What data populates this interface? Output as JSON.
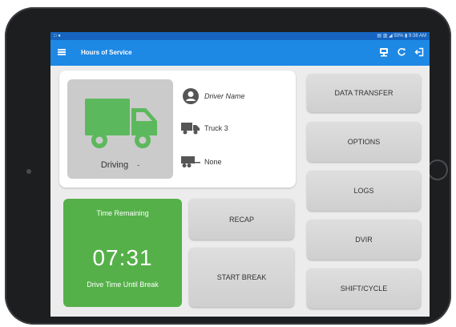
{
  "statusbar": {
    "left": "□ ●",
    "right": "▤ ▥ ◢ 93% ▮ 9:38 AM"
  },
  "appbar": {
    "title": "Hours of Service",
    "icons": [
      "menu-icon",
      "computer-icon",
      "refresh-icon",
      "logout-icon"
    ]
  },
  "driver": {
    "status": "Driving",
    "status_caret": "-",
    "name": "Driver Name",
    "vehicle": "Truck 3",
    "trailer": "None"
  },
  "time": {
    "title": "Time Remaining",
    "value": "07:31",
    "subtitle": "Drive Time Until Break"
  },
  "buttons": {
    "recap": "RECAP",
    "start_break": "START BREAK",
    "data_transfer": "DATA TRANSFER",
    "options": "OPTIONS",
    "logs": "LOGS",
    "dvir": "DVIR",
    "shift_cycle": "SHIFT/CYCLE"
  },
  "colors": {
    "appbar": "#1e88e5",
    "statusbar": "#1565c0",
    "driving_green": "#55b049",
    "truck_green": "#5cb85c",
    "button_gray": "#d6d6d6"
  }
}
